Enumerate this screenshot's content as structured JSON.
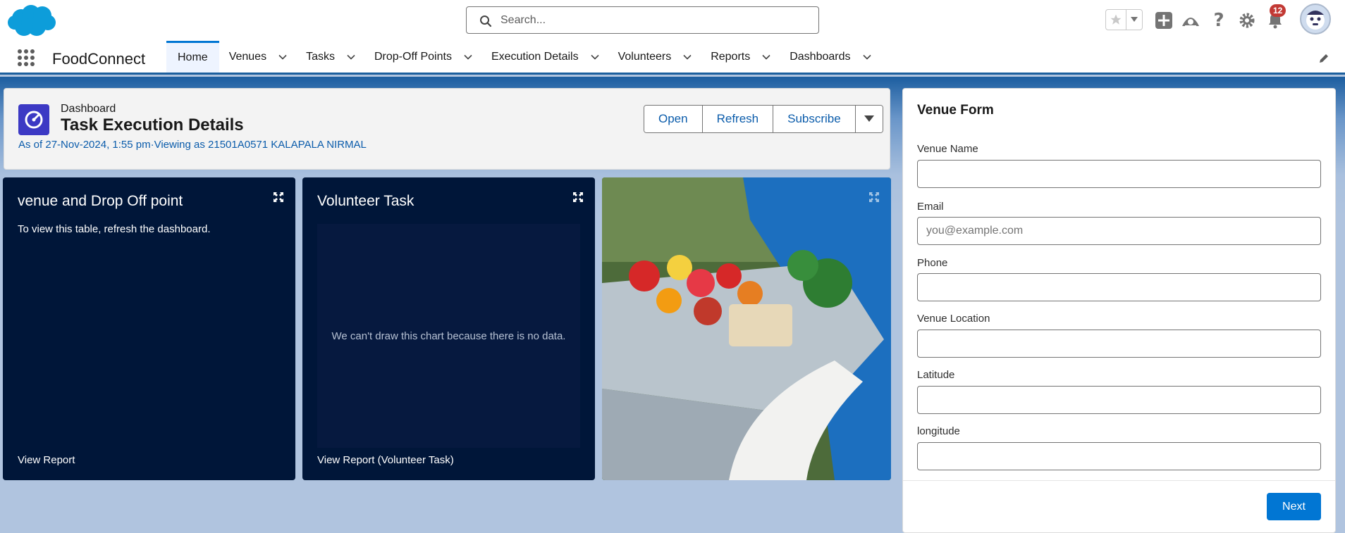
{
  "header": {
    "search_placeholder": "Search...",
    "notification_count": "12"
  },
  "nav": {
    "app_name": "FoodConnect",
    "tabs": [
      {
        "label": "Home",
        "active": true
      },
      {
        "label": "Venues"
      },
      {
        "label": "Tasks"
      },
      {
        "label": "Drop-Off Points"
      },
      {
        "label": "Execution Details"
      },
      {
        "label": "Volunteers"
      },
      {
        "label": "Reports"
      },
      {
        "label": "Dashboards"
      }
    ]
  },
  "dashboard": {
    "eyebrow": "Dashboard",
    "title": "Task Execution Details",
    "meta": "As of 27-Nov-2024, 1:55 pm·Viewing as 21501A0571 KALAPALA NIRMAL",
    "buttons": {
      "open": "Open",
      "refresh": "Refresh",
      "subscribe": "Subscribe"
    }
  },
  "widgets": [
    {
      "title": "venue and Drop Off point",
      "message": "To view this table, refresh the dashboard.",
      "report_link": "View Report"
    },
    {
      "title": "Volunteer Task",
      "message": "We can't draw this chart because there is no data.",
      "report_link": "View Report (Volunteer Task)"
    }
  ],
  "venue_form": {
    "title": "Venue Form",
    "fields": [
      {
        "label": "Venue Name",
        "placeholder": "",
        "value": ""
      },
      {
        "label": "Email",
        "placeholder": "you@example.com",
        "value": ""
      },
      {
        "label": "Phone",
        "placeholder": "",
        "value": ""
      },
      {
        "label": "Venue Location",
        "placeholder": "",
        "value": ""
      },
      {
        "label": "Latitude",
        "placeholder": "",
        "value": ""
      },
      {
        "label": "longitude",
        "placeholder": "",
        "value": ""
      }
    ],
    "next_label": "Next"
  },
  "colors": {
    "brand_blue": "#0176d3",
    "link_blue": "#0b5cab",
    "widget_bg": "#001639",
    "dashboard_icon": "#3c39c4",
    "badge_red": "#c23934"
  }
}
